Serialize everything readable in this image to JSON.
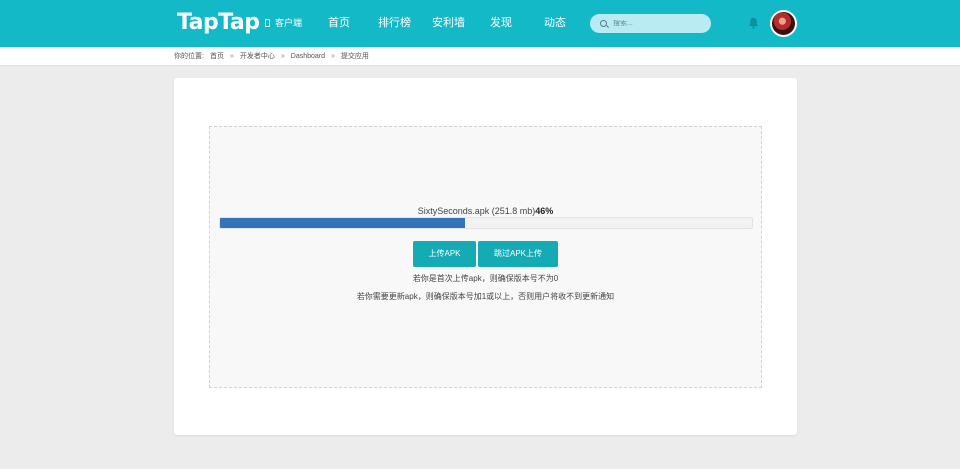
{
  "header": {
    "logo": "TapTap",
    "client_label": "客户端",
    "nav": [
      "首页",
      "排行榜",
      "安利墙",
      "发现",
      "动态"
    ],
    "search_placeholder": "搜索...",
    "brand_color": "#14b9c8"
  },
  "breadcrumb": {
    "prefix": "你的位置:",
    "items": [
      "首页",
      "开发者中心",
      "Dashboard",
      "提交应用"
    ],
    "separator": "»"
  },
  "upload": {
    "file_name": "SixtySeconds.apk",
    "file_size": "(251.8 mb)",
    "progress_label": "46%",
    "progress_value": 0.46,
    "progress_color": "#3373b7",
    "upload_button": "上传APK",
    "skip_button": "跳过APK上传",
    "note_first": "若你是首次上传apk，则确保版本号不为0",
    "note_update": "若你需要更新apk，则确保版本号加1或以上，否则用户将收不到更新通知"
  }
}
